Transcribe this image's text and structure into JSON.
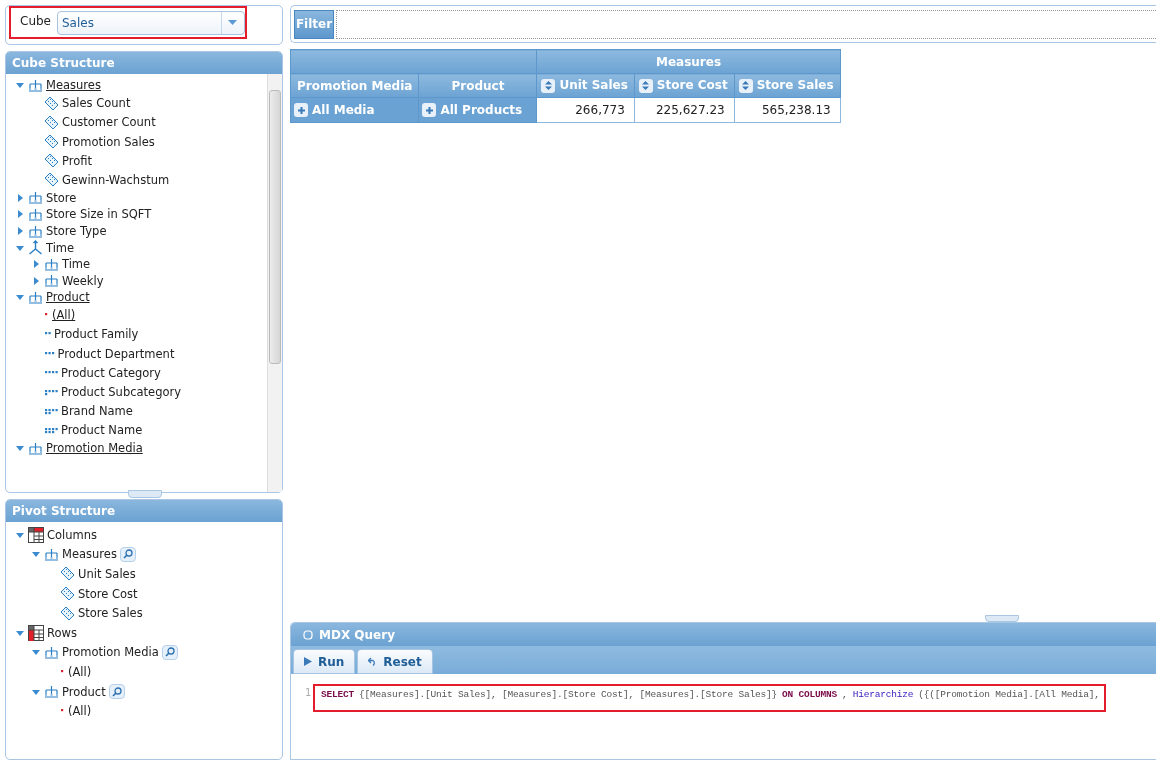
{
  "cube_selector": {
    "label": "Cube",
    "value": "Sales",
    "highlighted": true
  },
  "cube_structure": {
    "title": "Cube Structure",
    "nodes": [
      {
        "kind": "hierarchy",
        "label": "Measures",
        "expanded": true,
        "underlined": true,
        "children": [
          {
            "kind": "measure",
            "label": "Sales Count",
            "underlined": false
          },
          {
            "kind": "measure",
            "label": "Customer Count",
            "underlined": false
          },
          {
            "kind": "measure",
            "label": "Promotion Sales",
            "underlined": false
          },
          {
            "kind": "measure",
            "label": "Profit",
            "underlined": false
          },
          {
            "kind": "measure",
            "label": "Gewinn-Wachstum",
            "underlined": false
          }
        ]
      },
      {
        "kind": "hierarchy",
        "label": "Store",
        "expanded": false,
        "underlined": false
      },
      {
        "kind": "hierarchy",
        "label": "Store Size in SQFT",
        "expanded": false,
        "underlined": false
      },
      {
        "kind": "hierarchy",
        "label": "Store Type",
        "expanded": false,
        "underlined": false
      },
      {
        "kind": "dimension",
        "label": "Time",
        "expanded": true,
        "underlined": false,
        "children": [
          {
            "kind": "hierarchy",
            "label": "Time",
            "expanded": false,
            "underlined": false
          },
          {
            "kind": "hierarchy",
            "label": "Weekly",
            "expanded": false,
            "underlined": false
          }
        ]
      },
      {
        "kind": "hierarchy",
        "label": "Product",
        "expanded": true,
        "underlined": true,
        "children": [
          {
            "kind": "level",
            "label": "(All)",
            "underlined": true
          },
          {
            "kind": "level",
            "label": "Product Family",
            "underlined": false
          },
          {
            "kind": "level",
            "label": "Product Department",
            "underlined": false
          },
          {
            "kind": "level",
            "label": "Product Category",
            "underlined": false
          },
          {
            "kind": "level",
            "label": "Product Subcategory",
            "underlined": false
          },
          {
            "kind": "level",
            "label": "Brand Name",
            "underlined": false
          },
          {
            "kind": "level",
            "label": "Product Name",
            "underlined": false
          }
        ]
      },
      {
        "kind": "hierarchy",
        "label": "Promotion Media",
        "expanded": true,
        "underlined": true
      }
    ]
  },
  "pivot_structure": {
    "title": "Pivot Structure",
    "nodes": [
      {
        "kind": "columns-axis",
        "label": "Columns",
        "expanded": true,
        "children": [
          {
            "kind": "hierarchy",
            "label": "Measures",
            "expanded": true,
            "search": true,
            "children": [
              {
                "kind": "measure",
                "label": "Unit Sales"
              },
              {
                "kind": "measure",
                "label": "Store Cost"
              },
              {
                "kind": "measure",
                "label": "Store Sales"
              }
            ]
          }
        ]
      },
      {
        "kind": "rows-axis",
        "label": "Rows",
        "expanded": true,
        "children": [
          {
            "kind": "hierarchy",
            "label": "Promotion Media",
            "expanded": true,
            "search": true,
            "children": [
              {
                "kind": "level",
                "label": "(All)"
              }
            ]
          },
          {
            "kind": "hierarchy",
            "label": "Product",
            "expanded": true,
            "search": true,
            "children": [
              {
                "kind": "level",
                "label": "(All)"
              }
            ]
          }
        ]
      }
    ]
  },
  "filter": {
    "label": "Filter"
  },
  "pivot_table": {
    "group_header": "Measures",
    "row_headers": [
      "Promotion Media",
      "Product"
    ],
    "columns": [
      "Unit Sales",
      "Store Cost",
      "Store Sales"
    ],
    "rows": [
      {
        "members": [
          "All Media",
          "All Products"
        ],
        "cells": [
          "266,773",
          "225,627.23",
          "565,238.13"
        ]
      }
    ]
  },
  "mdx_query": {
    "title": "MDX Query",
    "buttons": [
      {
        "kind": "run",
        "label": "Run"
      },
      {
        "kind": "reset",
        "label": "Reset"
      }
    ],
    "highlighted": true,
    "line_number": "1",
    "tokens": [
      {
        "kind": "keyword",
        "text": "SELECT"
      },
      {
        "kind": "plain",
        "text": "{[Measures].[Unit Sales], [Measures].[Store Cost], [Measures].[Store Sales]}"
      },
      {
        "kind": "keyword",
        "text": "ON COLUMNS"
      },
      {
        "kind": "plain",
        "text": ","
      },
      {
        "kind": "function",
        "text": "Hierarchize"
      },
      {
        "kind": "plain",
        "text": "({([Promotion Media].[All Media],"
      }
    ]
  }
}
